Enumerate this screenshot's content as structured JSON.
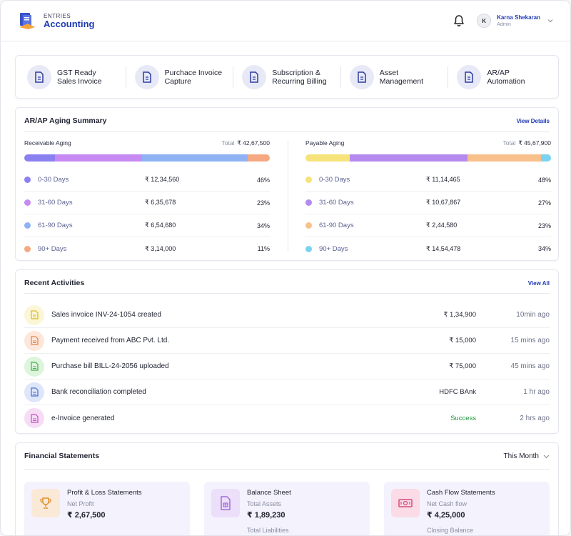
{
  "app": {
    "small_title": "ENTRIES",
    "title": "Accounting"
  },
  "user": {
    "initial": "K",
    "name": "Karna Shekaran",
    "role": "Admin"
  },
  "quick_links": [
    {
      "label": "GST Ready\nSales Invoice"
    },
    {
      "label": "Purchace Invoice\nCapture"
    },
    {
      "label": "Subscription &\nRecurring Billing"
    },
    {
      "label": "Asset\nManagement"
    },
    {
      "label": "AR/AP\nAutomation"
    }
  ],
  "aging": {
    "title": "AR/AP Aging Summary",
    "view_details": "View Details",
    "receivable": {
      "title": "Receivable Aging",
      "total_label": "Total",
      "total": "₹ 42,67,500",
      "rows": [
        {
          "label": "0-30 Days",
          "amount": "₹ 12,34,560",
          "pct": "46%",
          "color": "#8b80f0"
        },
        {
          "label": "31-60 Days",
          "amount": "₹ 6,35,678",
          "pct": "23%",
          "color": "#c78af2"
        },
        {
          "label": "61-90 Days",
          "amount": "₹ 6,54,680",
          "pct": "34%",
          "color": "#8fb2f5"
        },
        {
          "label": "90+ Days",
          "amount": "₹ 3,14,000",
          "pct": "11%",
          "color": "#f5a982"
        }
      ]
    },
    "payable": {
      "title": "Payable Aging",
      "total_label": "Total",
      "total": "₹ 45,67,900",
      "rows": [
        {
          "label": "0-30 Days",
          "amount": "₹ 11,14,465",
          "pct": "48%",
          "color": "#f6e37a"
        },
        {
          "label": "31-60 Days",
          "amount": "₹ 10,67,867",
          "pct": "27%",
          "color": "#b58aee"
        },
        {
          "label": "61-90 Days",
          "amount": "₹ 2,44,580",
          "pct": "23%",
          "color": "#f8c08a"
        },
        {
          "label": "90+ Days",
          "amount": "₹ 14,54,478",
          "pct": "34%",
          "color": "#7ad3f0"
        }
      ]
    }
  },
  "activities": {
    "title": "Recent Activities",
    "view_all": "View All",
    "items": [
      {
        "text": "Sales invoice INV-24-1054 created",
        "value": "₹ 1,34,900",
        "time": "10min ago",
        "bg": "#fbf6d6",
        "fg": "#d8b92a"
      },
      {
        "text": "Payment received from ABC Pvt. Ltd.",
        "value": "₹ 15,000",
        "time": "15 mins ago",
        "bg": "#fde6da",
        "fg": "#e0824f"
      },
      {
        "text": "Purchase bill BILL-24-2056 uploaded",
        "value": "₹ 75,000",
        "time": "45 mins ago",
        "bg": "#dcf5dc",
        "fg": "#43ad4a"
      },
      {
        "text": "Bank reconciliation completed",
        "value": "HDFC BAnk",
        "time": "1 hr ago",
        "bg": "#dde6fa",
        "fg": "#4b6ec9"
      },
      {
        "text": "e-Invoice generated",
        "value": "Success",
        "time": "2 hrs ago",
        "bg": "#f6dcf5",
        "fg": "#c04fc4"
      }
    ]
  },
  "financial": {
    "title": "Financial Statements",
    "period": "This Month",
    "cards": [
      {
        "title": "Profit & Loss Statements",
        "sub": "Net Profit",
        "value": "₹ 2,67,500",
        "sub2": ""
      },
      {
        "title": "Balance Sheet",
        "sub": "Total Assets",
        "value": "₹ 1,89,230",
        "sub2": "Total Liabilities"
      },
      {
        "title": "Cash Flow Statements",
        "sub": "Net Cash flow",
        "value": "₹ 4,25,000",
        "sub2": "Closing Balance"
      }
    ]
  }
}
